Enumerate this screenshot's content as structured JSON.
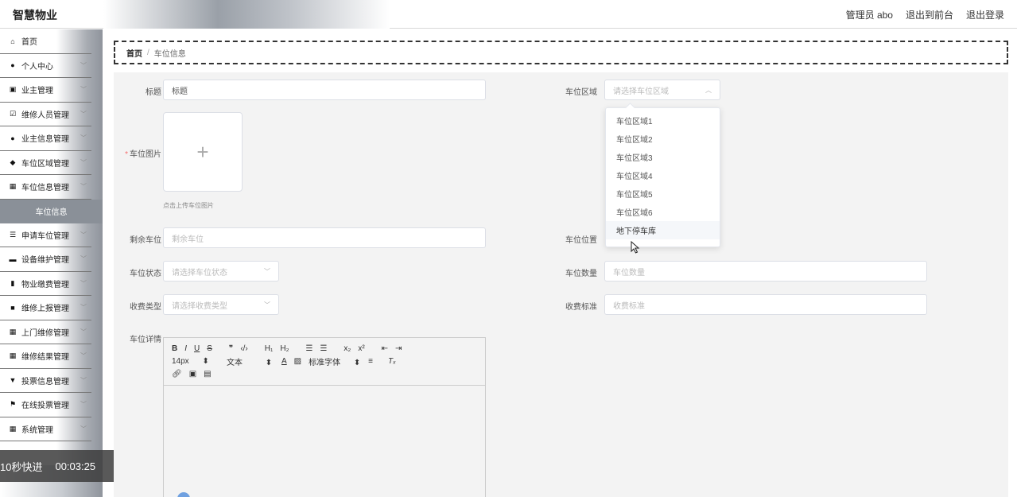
{
  "header": {
    "brand": "智慧物业",
    "user": "管理员 abo",
    "front_link": "退出到前台",
    "logout_link": "退出登录"
  },
  "sidebar": {
    "items": [
      {
        "label": "首页",
        "icon": "home-icon",
        "glyph": "⌂",
        "chevron": false
      },
      {
        "label": "个人中心",
        "icon": "person-icon",
        "glyph": "●",
        "chevron": true
      },
      {
        "label": "业主管理",
        "icon": "clipboard-icon",
        "glyph": "▣",
        "chevron": true
      },
      {
        "label": "维修人员管理",
        "icon": "checkbox-icon",
        "glyph": "☑",
        "chevron": true
      },
      {
        "label": "业主信息管理",
        "icon": "person-icon",
        "glyph": "●",
        "chevron": true
      },
      {
        "label": "车位区域管理",
        "icon": "pin-icon",
        "glyph": "◆",
        "chevron": true
      },
      {
        "label": "车位信息管理",
        "icon": "grid-icon",
        "glyph": "▦",
        "chevron": true
      }
    ],
    "sub_item": "车位信息",
    "items2": [
      {
        "label": "申请车位管理",
        "icon": "filter-icon",
        "glyph": "☰",
        "chevron": true
      },
      {
        "label": "设备维护管理",
        "icon": "card-icon",
        "glyph": "▬",
        "chevron": true
      },
      {
        "label": "物业缴费管理",
        "icon": "bar-chart-icon",
        "glyph": "▮",
        "chevron": true
      },
      {
        "label": "维修上报管理",
        "icon": "video-icon",
        "glyph": "■",
        "chevron": true
      },
      {
        "label": "上门维修管理",
        "icon": "grid-icon",
        "glyph": "▦",
        "chevron": true
      },
      {
        "label": "维修结果管理",
        "icon": "grid-icon",
        "glyph": "▦",
        "chevron": true
      },
      {
        "label": "投票信息管理",
        "icon": "trophy-icon",
        "glyph": "▼",
        "chevron": true
      },
      {
        "label": "在线投票管理",
        "icon": "flag-icon",
        "glyph": "⚑",
        "chevron": true
      },
      {
        "label": "系统管理",
        "icon": "grid-icon",
        "glyph": "▦",
        "chevron": true
      }
    ]
  },
  "video": {
    "skip_label": "10秒快进",
    "time": "00:03:25"
  },
  "breadcrumb": {
    "home": "首页",
    "separator": "/",
    "current": "车位信息"
  },
  "form": {
    "title_label": "标题",
    "title_value": "标题",
    "area_label": "车位区域",
    "area_placeholder": "请选择车位区域",
    "image_label": "车位图片",
    "image_hint": "点击上传车位图片",
    "remaining_label": "剩余车位",
    "remaining_placeholder": "剩余车位",
    "position_label": "车位位置",
    "status_label": "车位状态",
    "status_placeholder": "请选择车位状态",
    "count_label": "车位数量",
    "count_placeholder": "车位数量",
    "fee_type_label": "收费类型",
    "fee_type_placeholder": "请选择收费类型",
    "fee_std_label": "收费标准",
    "fee_std_placeholder": "收费标准",
    "detail_label": "车位详情"
  },
  "editor": {
    "font_size": "14px",
    "text_style": "文本",
    "font_family": "标准字体"
  },
  "dropdown": {
    "options": [
      "车位区域1",
      "车位区域2",
      "车位区域3",
      "车位区域4",
      "车位区域5",
      "车位区域6",
      "地下停车库"
    ],
    "hovered_index": 6
  }
}
